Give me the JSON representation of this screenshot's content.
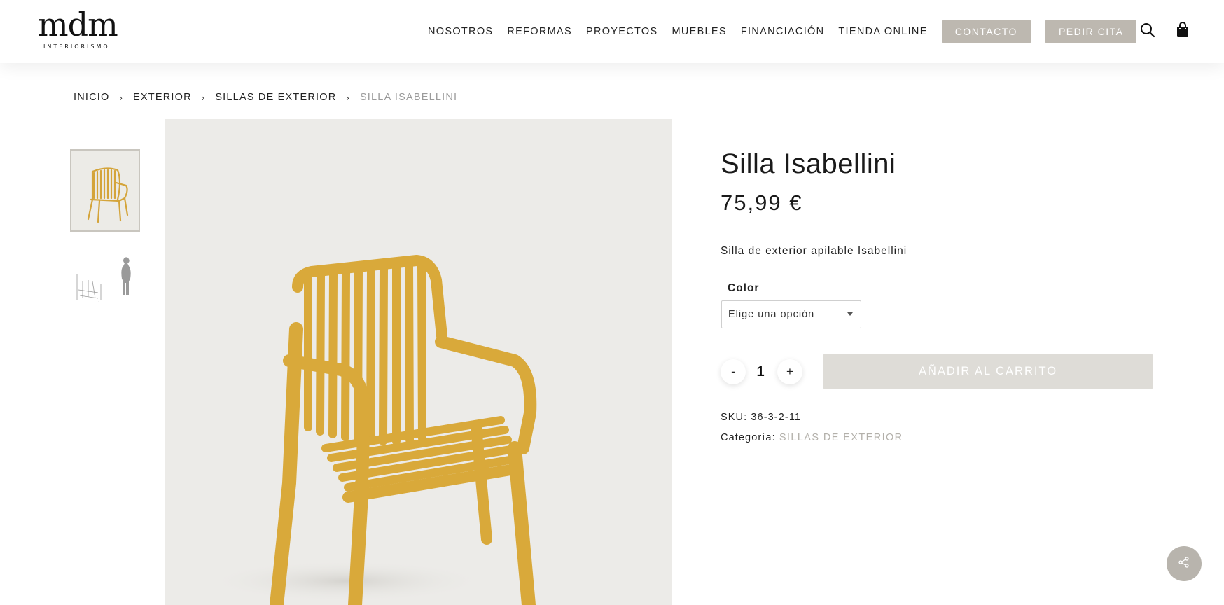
{
  "header": {
    "logo_text": "mdm",
    "logo_subtext": "INTERIORISMO",
    "nav": [
      "NOSOTROS",
      "REFORMAS",
      "PROYECTOS",
      "MUEBLES",
      "FINANCIACIÓN",
      "TIENDA ONLINE"
    ],
    "contact_button": "CONTACTO",
    "appointment_button": "PEDIR CITA",
    "icons": [
      "search-icon",
      "shopping-bag-icon"
    ]
  },
  "breadcrumb": [
    "INICIO",
    "EXTERIOR",
    "SILLAS DE EXTERIOR",
    "SILLA ISABELLINI"
  ],
  "product": {
    "title": "Silla Isabellini",
    "price": "75,99 €",
    "description": "Silla de exterior apilable Isabellini",
    "color_label": "Color",
    "color_select_value": "Elige una opción",
    "quantity": "1",
    "qty_minus": "-",
    "qty_plus": "+",
    "add_to_cart": "AÑADIR AL CARRITO",
    "sku_label": "SKU:",
    "sku_value": "36-3-2-11",
    "category_label": "Categoría:",
    "category_value": "SILLAS DE EXTERIOR"
  },
  "colors": {
    "accent": "#bdb8b0",
    "chair": "#d9a93a",
    "image_bg": "#ecebe8"
  }
}
